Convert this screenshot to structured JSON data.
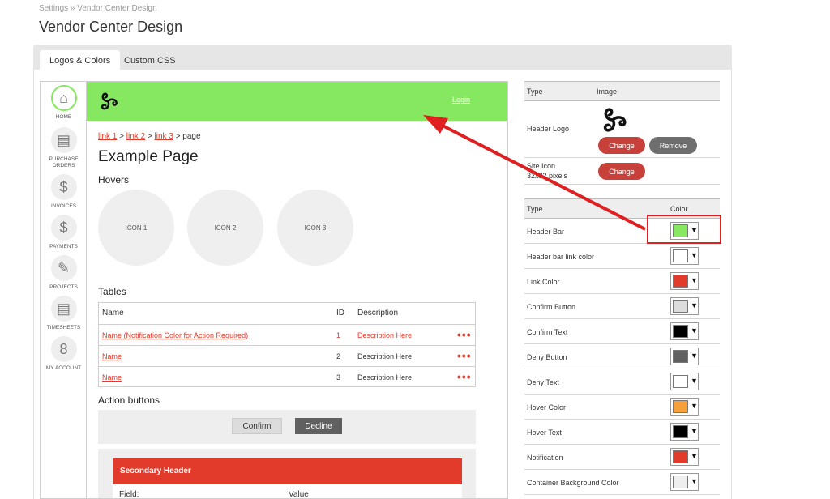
{
  "breadcrumb": "Settings » Vendor Center Design",
  "page_title": "Vendor Center Design",
  "tabs": [
    {
      "label": "Logos & Colors",
      "active": true
    },
    {
      "label": "Custom CSS",
      "active": false
    }
  ],
  "preview": {
    "nav": [
      {
        "label": "HOME",
        "icon": "home-icon",
        "glyph": "⌂"
      },
      {
        "label": "PURCHASE ORDERS",
        "icon": "document-icon",
        "glyph": "▤"
      },
      {
        "label": "INVOICES",
        "icon": "dollar-icon",
        "glyph": "$"
      },
      {
        "label": "PAYMENTS",
        "icon": "dollar-icon",
        "glyph": "$"
      },
      {
        "label": "PROJECTS",
        "icon": "pencil-icon",
        "glyph": "✎"
      },
      {
        "label": "TIMESHEETS",
        "icon": "timesheet-icon",
        "glyph": "▤"
      },
      {
        "label": "MY ACCOUNT",
        "icon": "user-icon",
        "glyph": "8"
      }
    ],
    "login": "Login",
    "crumbs": {
      "link1": "link 1",
      "link2": "link 2",
      "link3": "link 3",
      "sep": ">",
      "current": "page"
    },
    "title": "Example Page",
    "hovers_label": "Hovers",
    "hover_icons": [
      "ICON 1",
      "ICON 2",
      "ICON 3"
    ],
    "tables_label": "Tables",
    "table": {
      "headers": {
        "name": "Name",
        "id": "ID",
        "description": "Description"
      },
      "rows": [
        {
          "name": "Name (Notification Color for Action Required)",
          "id": "1",
          "description": "Description Here",
          "more": "•••"
        },
        {
          "name": "Name",
          "id": "2",
          "description": "Description Here",
          "more": "•••"
        },
        {
          "name": "Name",
          "id": "3",
          "description": "Description Here",
          "more": "•••"
        }
      ]
    },
    "actions_label": "Action buttons",
    "confirm": "Confirm",
    "decline": "Decline",
    "secondary_header": "Secondary Header",
    "field_label": "Field:",
    "value_label": "Value"
  },
  "logo_table": {
    "headers": {
      "type": "Type",
      "image": "Image"
    },
    "header_logo": "Header Logo",
    "site_icon": "Site Icon",
    "site_icon_size": "32x32 pixels",
    "change": "Change",
    "remove": "Remove"
  },
  "color_table": {
    "headers": {
      "type": "Type",
      "color": "Color"
    },
    "rows": [
      {
        "label": "Header Bar",
        "color": "#86e860"
      },
      {
        "label": "Header bar link color",
        "color": "#ffffff"
      },
      {
        "label": "Link Color",
        "color": "#e23a2b"
      },
      {
        "label": "Confirm Button",
        "color": "#dcdcdc"
      },
      {
        "label": "Confirm Text",
        "color": "#000000"
      },
      {
        "label": "Deny Button",
        "color": "#606060"
      },
      {
        "label": "Deny Text",
        "color": "#ffffff"
      },
      {
        "label": "Hover Color",
        "color": "#f5a03a"
      },
      {
        "label": "Hover Text",
        "color": "#000000"
      },
      {
        "label": "Notification",
        "color": "#e23a2b"
      },
      {
        "label": "Container Background Color",
        "color": "#eeeeee"
      }
    ],
    "caret": "▼"
  },
  "colors": {
    "accent_green": "#86e860",
    "accent_red": "#e23a2b",
    "annotation_red": "#e02020"
  }
}
